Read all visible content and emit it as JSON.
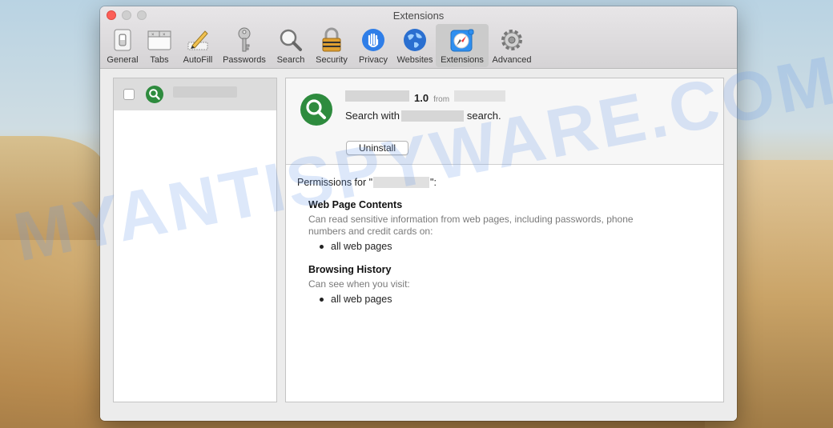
{
  "window": {
    "title": "Extensions"
  },
  "toolbar": {
    "items": [
      {
        "label": "General",
        "icon": "general-switch-icon"
      },
      {
        "label": "Tabs",
        "icon": "tabs-window-icon"
      },
      {
        "label": "AutoFill",
        "icon": "pencil-form-icon"
      },
      {
        "label": "Passwords",
        "icon": "key-icon"
      },
      {
        "label": "Search",
        "icon": "magnifier-icon"
      },
      {
        "label": "Security",
        "icon": "padlock-icon"
      },
      {
        "label": "Privacy",
        "icon": "hand-icon"
      },
      {
        "label": "Websites",
        "icon": "globe-icon"
      },
      {
        "label": "Extensions",
        "icon": "compass-puzzle-icon",
        "active": true
      },
      {
        "label": "Advanced",
        "icon": "gear-icon"
      }
    ]
  },
  "extension": {
    "version": "1.0",
    "from_label": "from",
    "description_prefix": "Search with",
    "description_suffix": "search.",
    "uninstall_label": "Uninstall",
    "icon_color": "#2e8b3e"
  },
  "permissions": {
    "header_prefix": "Permissions for \"",
    "header_suffix": "\":",
    "sections": [
      {
        "title": "Web Page Contents",
        "description": "Can read sensitive information from web pages, including passwords, phone numbers and credit cards on:",
        "items": [
          "all web pages"
        ]
      },
      {
        "title": "Browsing History",
        "description": "Can see when you visit:",
        "items": [
          "all web pages"
        ]
      }
    ]
  },
  "watermark": "MYANTISPYWARE.COM",
  "colors": {
    "close": "#fc5f57",
    "active_tab": "#cbcbcb",
    "watermark": "#6496e6"
  }
}
